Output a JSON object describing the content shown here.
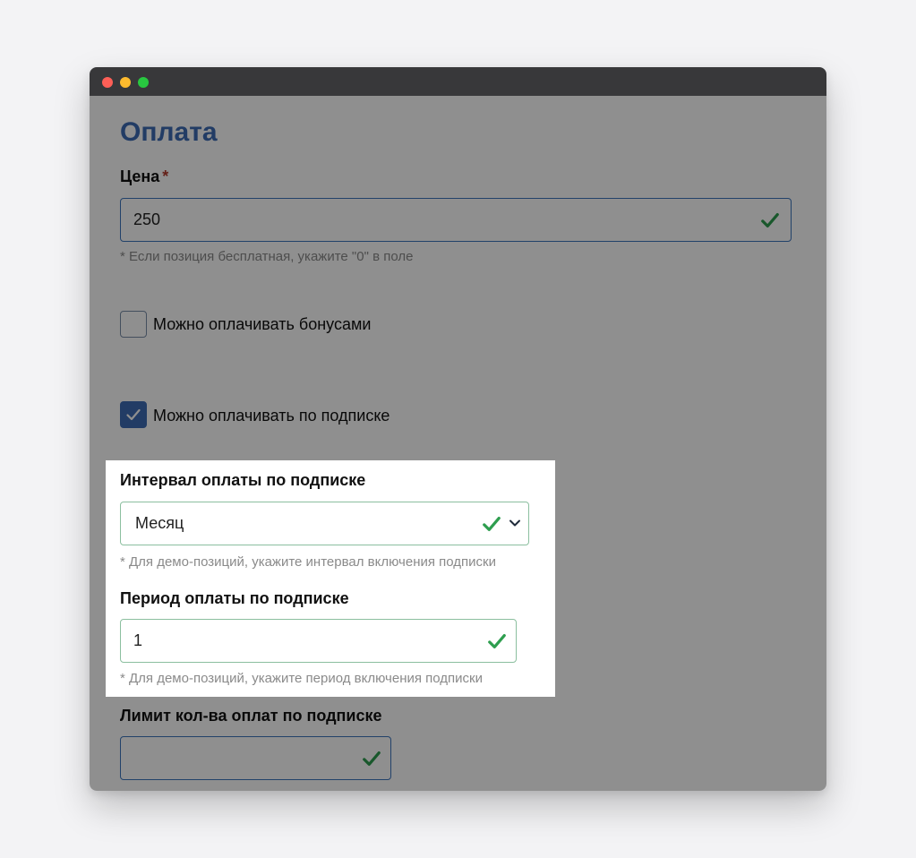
{
  "window": {
    "title": ""
  },
  "page": {
    "title": "Оплата"
  },
  "price": {
    "label": "Цена",
    "required_mark": "*",
    "value": "250",
    "hint": "* Если позиция бесплатная, укажите \"0\" в поле"
  },
  "bonus_checkbox": {
    "label": "Можно оплачивать бонусами",
    "checked": false
  },
  "subscription_checkbox": {
    "label": "Можно оплачивать по подписке",
    "checked": true
  },
  "interval": {
    "label": "Интервал оплаты по подписке",
    "selected": "Месяц",
    "hint": "* Для демо-позиций, укажите интервал включения подписки"
  },
  "period": {
    "label": "Период оплаты по подписке",
    "value": "1",
    "hint": "* Для демо-позиций, укажите период включения подписки"
  },
  "limit": {
    "label": "Лимит кол-ва оплат по подписке",
    "value": ""
  },
  "colors": {
    "accent": "#3d6cb4",
    "success": "#2e9e4f",
    "required": "#b23a2e"
  }
}
